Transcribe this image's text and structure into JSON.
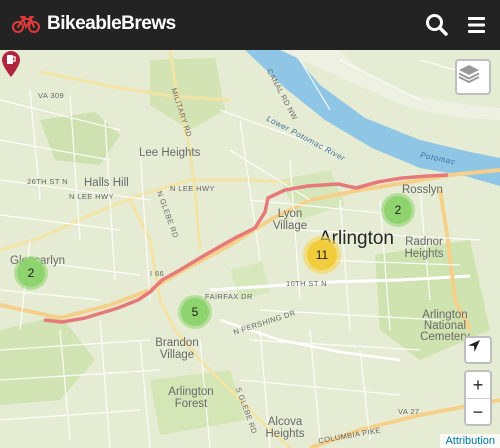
{
  "app": {
    "title": "BikeableBrews"
  },
  "header": {
    "search_icon": "search-icon",
    "menu_icon": "hamburger-menu-icon"
  },
  "map_labels": {
    "areas": [
      "Lee Heights",
      "Halls Hill",
      "Lyon Village",
      "Arlington",
      "Rosslyn",
      "Radnor Heights",
      "Glencarlyn",
      "Brandon Village",
      "Arlington Forest",
      "Alcova Heights",
      "Arlington National Cemetery"
    ],
    "roads": [
      "VA 309",
      "MILITARY RD",
      "26TH ST N",
      "N LEE HWY",
      "N LEE HWY",
      "N GLEBE RD",
      "CANAL RD NW",
      "I 66",
      "FAIRFAX DR",
      "10TH ST N",
      "N PERSHING DR",
      "S GLEBE RD",
      "VA 27",
      "COLUMBIA PIKE"
    ],
    "water": [
      "Lower Potomac River",
      "Potomac"
    ]
  },
  "clusters": [
    {
      "count": "2",
      "color": "#8fd36f",
      "name": "cluster-glencarlyn"
    },
    {
      "count": "2",
      "color": "#8fd36f",
      "name": "cluster-rosslyn"
    },
    {
      "count": "11",
      "color": "#f1cc3d",
      "name": "cluster-arlington"
    },
    {
      "count": "5",
      "color": "#8fd36f",
      "name": "cluster-brandon"
    }
  ],
  "controls": {
    "zoom_in": "+",
    "zoom_out": "−",
    "attribution": "Attribution",
    "layers_icon": "layers-icon",
    "locate_icon": "locate-arrow-icon"
  },
  "colors": {
    "header_bg": "#232323",
    "brand_red": "#e03a3a",
    "route": "#e8767a",
    "brewery_marker": "#b0243d"
  }
}
